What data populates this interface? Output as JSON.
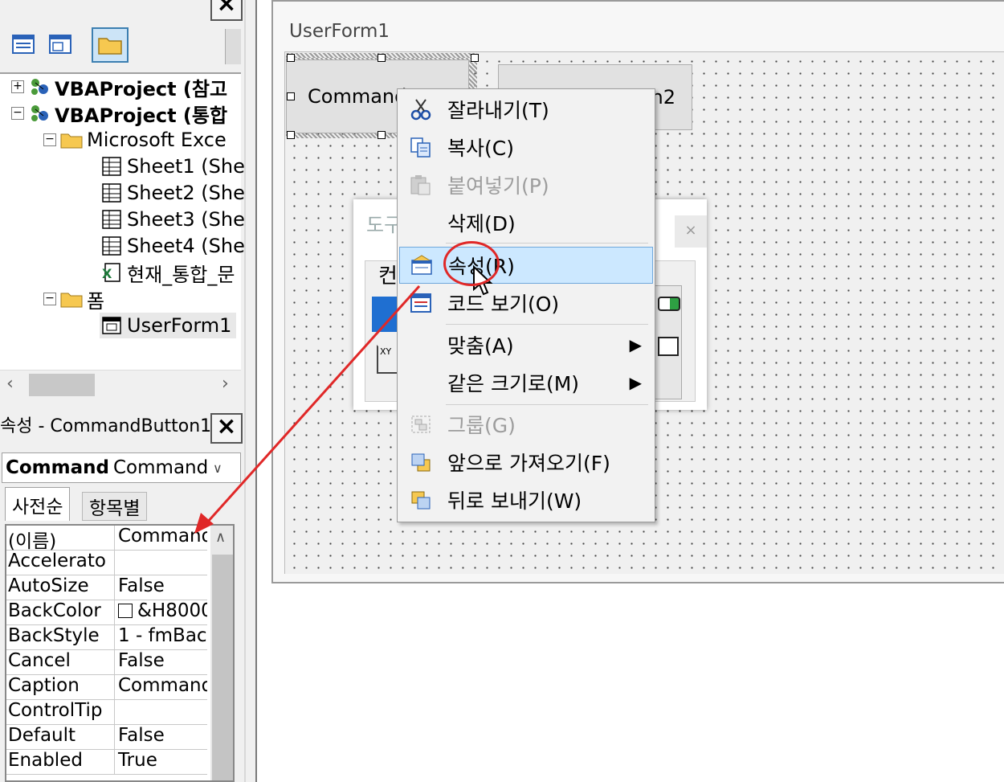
{
  "project_tree": {
    "rows": [
      {
        "expander": "+",
        "label": "VBAProject (참고",
        "bold": true
      },
      {
        "expander": "−",
        "label": "VBAProject (통합",
        "bold": true
      },
      {
        "expander": "−",
        "label": "Microsoft Exce"
      },
      {
        "label": "Sheet1 (She"
      },
      {
        "label": "Sheet2 (She"
      },
      {
        "label": "Sheet3 (She"
      },
      {
        "label": "Sheet4 (She"
      },
      {
        "label": "현재_통합_문"
      },
      {
        "expander": "−",
        "label": "폼"
      },
      {
        "label": "UserForm1"
      }
    ]
  },
  "properties": {
    "title": "속성 - CommandButton1",
    "combo_name": "Command",
    "combo_type": "Command",
    "tabs": [
      "사전순",
      "항목별"
    ],
    "rows": [
      {
        "name": "(이름)",
        "value": "Command"
      },
      {
        "name": "Accelerato",
        "value": ""
      },
      {
        "name": "AutoSize",
        "value": "False"
      },
      {
        "name": "BackColor",
        "value": "&H8000"
      },
      {
        "name": "BackStyle",
        "value": "1 - fmBac"
      },
      {
        "name": "Cancel",
        "value": "False"
      },
      {
        "name": "Caption",
        "value": "Command"
      },
      {
        "name": "ControlTip",
        "value": ""
      },
      {
        "name": "Default",
        "value": "False"
      },
      {
        "name": "Enabled",
        "value": "True"
      }
    ]
  },
  "userform": {
    "title": "UserForm1",
    "button1": "Command",
    "button2": "n2"
  },
  "toolbox": {
    "title": "도구",
    "close": "×",
    "tab_fragment": "컨"
  },
  "context_menu": {
    "items": [
      {
        "label": "잘라내기(T)",
        "icon": "scissors-icon"
      },
      {
        "label": "복사(C)",
        "icon": "copy-icon"
      },
      {
        "label": "붙여넣기(P)",
        "icon": "paste-icon",
        "disabled": true
      },
      {
        "label": "삭제(D)"
      },
      {
        "label": "속성(R)",
        "icon": "properties-icon",
        "highlighted": true
      },
      {
        "label": "코드 보기(O)",
        "icon": "view-code-icon"
      },
      {
        "label": "맞춤(A)",
        "submenu": true
      },
      {
        "label": "같은 크기로(M)",
        "submenu": true
      },
      {
        "label": "그룹(G)",
        "icon": "group-icon",
        "disabled": true
      },
      {
        "label": "앞으로 가져오기(F)",
        "icon": "bring-front-icon"
      },
      {
        "label": "뒤로 보내기(W)",
        "icon": "send-back-icon"
      }
    ]
  },
  "colors": {
    "highlight": "#cce8ff",
    "annotation": "#e02828"
  }
}
